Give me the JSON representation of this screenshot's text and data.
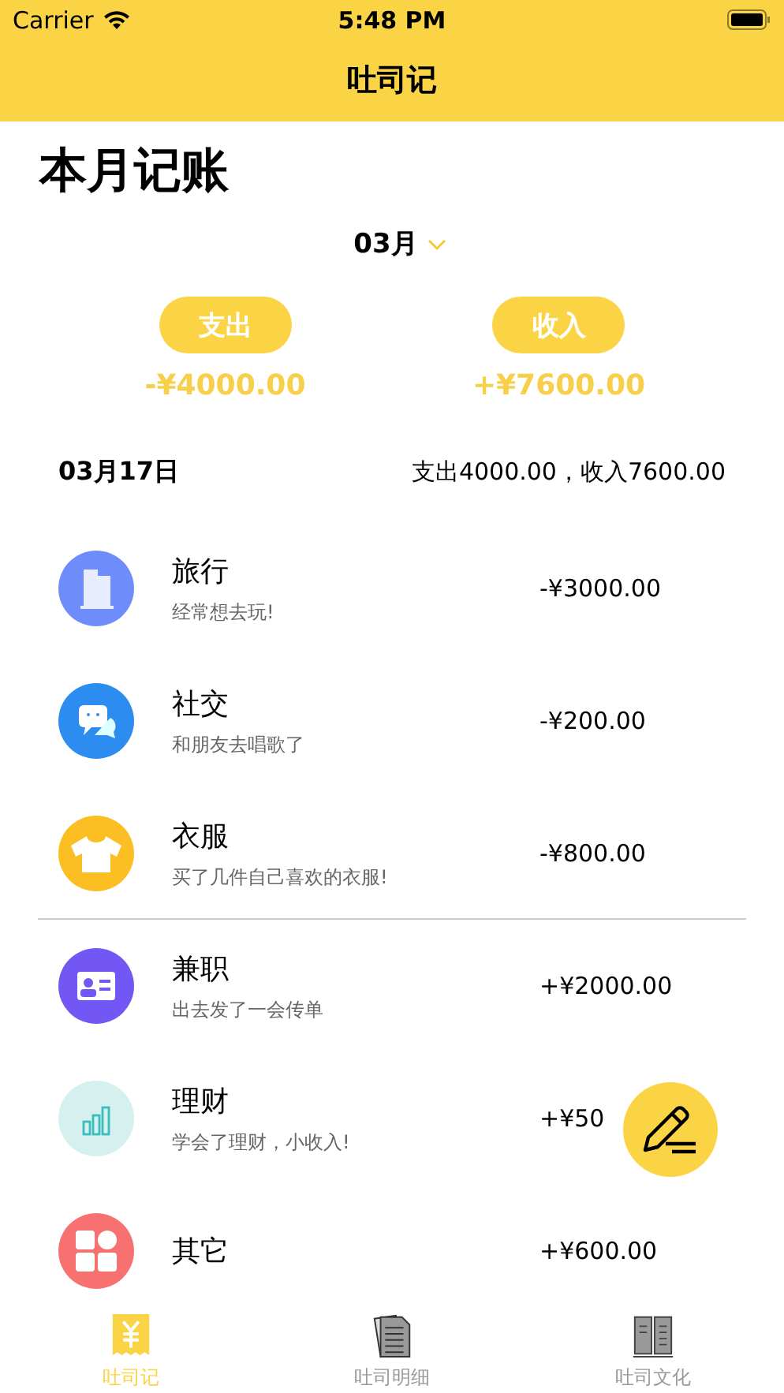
{
  "status_bar": {
    "carrier": "Carrier",
    "time": "5:48 PM"
  },
  "nav_bar": {
    "title": "吐司记"
  },
  "page_title": "本月记账",
  "month_picker": {
    "label": "03月"
  },
  "summary": [
    {
      "label": "支出",
      "amount": "-¥4000.00"
    },
    {
      "label": "收入",
      "amount": "+¥7600.00"
    }
  ],
  "day": {
    "date": "03月17日",
    "totals": "支出4000.00，收入7600.00"
  },
  "groups": [
    {
      "entries": [
        {
          "name": "旅行",
          "note": "经常想去玩!",
          "amount": "-¥3000.00",
          "color": "#6f8cfb"
        },
        {
          "name": "社交",
          "note": "和朋友去唱歌了",
          "amount": "-¥200.00",
          "color": "#2d8cf0"
        },
        {
          "name": "衣服",
          "note": "买了几件自己喜欢的衣服!",
          "amount": "-¥800.00",
          "color": "#fbbf24"
        }
      ]
    },
    {
      "entries": [
        {
          "name": "兼职",
          "note": "出去发了一会传单",
          "amount": "+¥2000.00",
          "color": "#7257f5"
        },
        {
          "name": "理财",
          "note": "学会了理财，小收入!",
          "amount": "+¥50",
          "color": "#d6f0f0"
        },
        {
          "name": "其它",
          "amount": "+¥600.00",
          "color": "#f87171"
        }
      ]
    }
  ],
  "tab_bar": [
    {
      "label": "吐司记",
      "selected": true
    },
    {
      "label": "吐司明细",
      "selected": false
    },
    {
      "label": "吐司文化",
      "selected": false
    }
  ]
}
